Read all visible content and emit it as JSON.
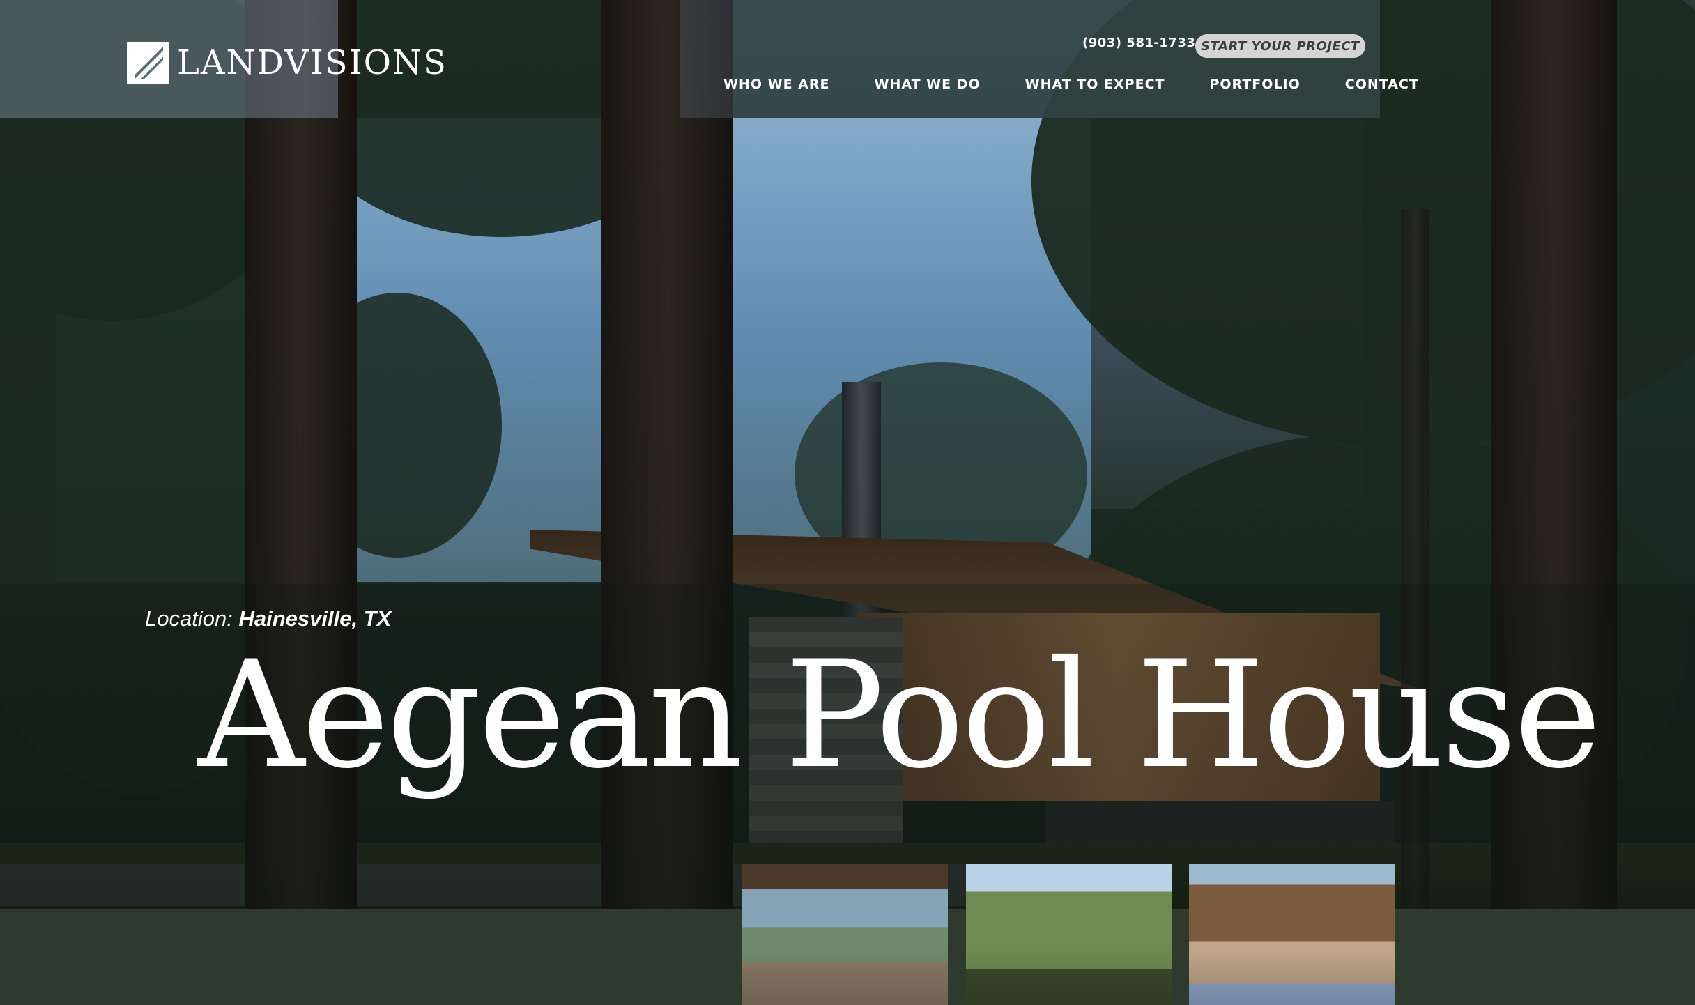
{
  "brand": {
    "name": "LANDVISIONS"
  },
  "header": {
    "phone": "(903) 581-1733",
    "cta_label": "START YOUR PROJECT"
  },
  "nav": {
    "items": [
      {
        "label": "WHO WE ARE"
      },
      {
        "label": "WHAT WE DO"
      },
      {
        "label": "WHAT TO EXPECT"
      },
      {
        "label": "PORTFOLIO"
      },
      {
        "label": "CONTACT"
      }
    ]
  },
  "project": {
    "location_label": "Location:",
    "location_value": "Hainesville, TX",
    "title": "Aegean Pool House"
  },
  "colors": {
    "accent_dark_green": "#2f3a2e",
    "cta_bg": "#d4d4d4",
    "text_light": "#ffffff"
  },
  "icons": {
    "logo": "leaf-logo-icon"
  }
}
